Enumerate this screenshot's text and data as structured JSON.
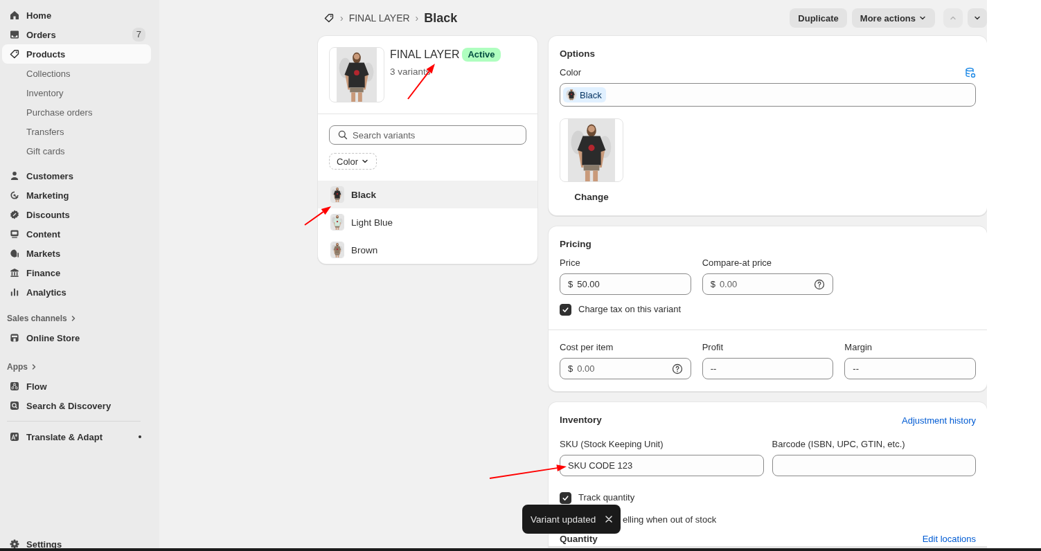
{
  "sidebar": {
    "sections": [
      {
        "items": [
          {
            "label": "Home",
            "kind": "main",
            "selected": false
          },
          {
            "label": "Orders",
            "kind": "main",
            "selected": false,
            "badge": "7"
          },
          {
            "label": "Products",
            "kind": "main",
            "selected": true
          },
          {
            "label": "Collections",
            "kind": "sub",
            "selected": false
          },
          {
            "label": "Inventory",
            "kind": "sub",
            "selected": false
          },
          {
            "label": "Purchase orders",
            "kind": "sub",
            "selected": false
          },
          {
            "label": "Transfers",
            "kind": "sub",
            "selected": false
          },
          {
            "label": "Gift cards",
            "kind": "sub",
            "selected": false
          }
        ]
      },
      {
        "items": [
          {
            "label": "Customers",
            "kind": "main",
            "selected": false
          },
          {
            "label": "Marketing",
            "kind": "main",
            "selected": false
          },
          {
            "label": "Discounts",
            "kind": "main",
            "selected": false
          },
          {
            "label": "Content",
            "kind": "main",
            "selected": false
          },
          {
            "label": "Markets",
            "kind": "main",
            "selected": false
          },
          {
            "label": "Finance",
            "kind": "main",
            "selected": false
          },
          {
            "label": "Analytics",
            "kind": "main",
            "selected": false
          }
        ]
      },
      {
        "heading": "Sales channels",
        "items": [
          {
            "label": "Online Store",
            "kind": "main",
            "selected": false
          }
        ]
      },
      {
        "heading": "Apps",
        "items": [
          {
            "label": "Flow",
            "kind": "main",
            "selected": false
          },
          {
            "label": "Search & Discovery",
            "kind": "main",
            "selected": false
          }
        ]
      },
      {
        "divider_above": true,
        "items": [
          {
            "label": "Translate & Adapt",
            "kind": "main",
            "selected": false,
            "unread": true
          }
        ]
      }
    ],
    "footer": {
      "label": "Settings"
    }
  },
  "breadcrumb": {
    "separators": [
      "›",
      "›"
    ],
    "parent": "FINAL LAYER",
    "current": "Black"
  },
  "header_actions": [
    {
      "label": "Duplicate",
      "kind": "button"
    },
    {
      "label": "More actions",
      "kind": "menu"
    }
  ],
  "pager": {
    "previous_disabled": true,
    "next_disabled": false
  },
  "product": {
    "title": "FINAL LAYER",
    "status": "Active",
    "variant_count": "3 variants",
    "search": {
      "placeholder": "Search variants"
    },
    "filter": "Color",
    "variants": [
      {
        "label": "Black",
        "selected": true
      },
      {
        "label": "Light Blue",
        "selected": false
      },
      {
        "label": "Brown",
        "selected": false
      }
    ]
  },
  "options": {
    "title": "Options",
    "option_name": "Color",
    "values": [
      "Black"
    ],
    "image_action": "Change"
  },
  "pricing": {
    "title": "Pricing",
    "fields": [
      {
        "label": "Price",
        "prefix": "$",
        "value": "50.00",
        "help": false
      },
      {
        "label": "Compare-at price",
        "prefix": "$",
        "placeholder": "0.00",
        "help": true
      }
    ],
    "charge_tax": {
      "label": "Charge tax on this variant",
      "checked": true
    },
    "cost_fields": [
      {
        "label": "Cost per item",
        "prefix": "$",
        "placeholder": "0.00",
        "help": true
      },
      {
        "label": "Profit",
        "value": "--",
        "help": false
      },
      {
        "label": "Margin",
        "value": "--",
        "help": false
      }
    ]
  },
  "inventory": {
    "title": "Inventory",
    "link": "Adjustment history",
    "fields": [
      {
        "label": "SKU (Stock Keeping Unit)",
        "value": "SKU CODE 123"
      },
      {
        "label": "Barcode (ISBN, UPC, GTIN, etc.)"
      }
    ],
    "track_quantity": {
      "label": "Track quantity",
      "checked": true
    },
    "continue_selling_text": "elling when out of stock",
    "quantity": {
      "title": "Quantity",
      "link": "Edit locations"
    }
  },
  "toast": {
    "message": "Variant updated"
  }
}
